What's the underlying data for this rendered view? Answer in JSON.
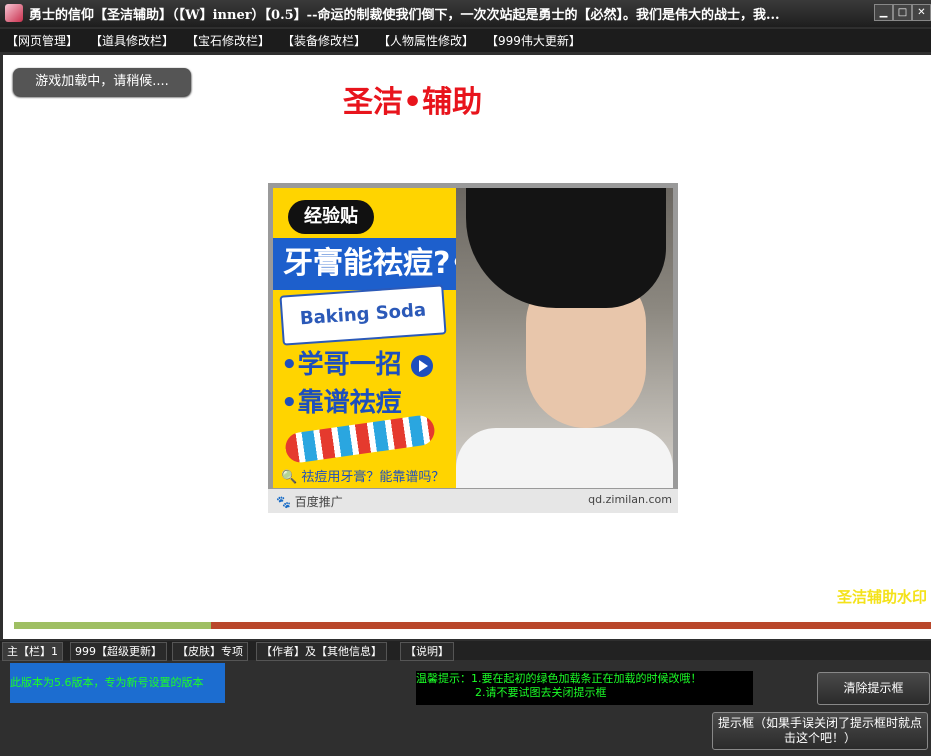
{
  "window": {
    "title": "勇士的信仰【圣洁辅助】（【W】inner）【0.5】--命运的制裁使我们倒下，一次次站起是勇士的【必然】。我们是伟大的战士，我...",
    "controls": [
      "▁",
      "□",
      "✕"
    ]
  },
  "menu": [
    "【网页管理】",
    "【道具修改栏】",
    "【宝石修改栏】",
    "【装备修改栏】",
    "【人物属性修改】",
    "【999伟大更新】"
  ],
  "content": {
    "loading_text": "游戏加载中，请稍候....",
    "heading": "圣洁•辅助",
    "watermark": "圣洁辅助水印",
    "progress_fraction": 0.215
  },
  "ad": {
    "badge": "经验贴",
    "headline": "牙膏能祛痘?•",
    "product": "Baking Soda",
    "line1": "•学哥一招",
    "line2": "•靠谱祛痘",
    "search_text": "祛痘用牙膏？能靠谱吗？",
    "brand": "百度推广",
    "domain": "qd.zimilan.com"
  },
  "tabs": [
    "主【栏】1",
    "999【超级更新】",
    "【皮肤】专项",
    "【作者】及【其他信息】",
    "【说明】"
  ],
  "version_note": "此版本为5.6版本，专为新号设置的版本",
  "tips": {
    "line1": "温馨提示：1.要在起初的绿色加载条正在加载的时候改哦！",
    "line2": "2.请不要试图去关闭提示框"
  },
  "buttons": {
    "clear": "清除提示框",
    "hint": "提示框（如果手误关闭了提示框时就点击这个吧！）"
  },
  "colors": {
    "heading": "#e8141c",
    "watermark": "#f4e21a",
    "progress_done": "#9fbf63",
    "progress_remaining": "#b9472b",
    "status_text": "#1bff27"
  }
}
